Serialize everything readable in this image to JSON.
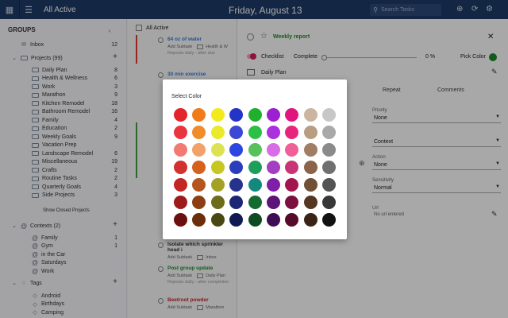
{
  "header": {
    "view_title": "All Active",
    "date": "Friday, August 13",
    "search_placeholder": "Search Tasks"
  },
  "sidebar": {
    "groups_title": "GROUPS",
    "inbox": {
      "label": "Inbox",
      "count": "12"
    },
    "projects": {
      "label": "Projects (99)"
    },
    "project_items": [
      {
        "label": "Daily Plan",
        "count": "8"
      },
      {
        "label": "Health & Wellness",
        "count": "6"
      },
      {
        "label": "Work",
        "count": "3"
      },
      {
        "label": "Marathon",
        "count": "9"
      },
      {
        "label": "Kitchen Remodel",
        "count": "18"
      },
      {
        "label": "Bathroom Remodel",
        "count": "16"
      },
      {
        "label": "Family",
        "count": "4"
      },
      {
        "label": "Education",
        "count": "2"
      },
      {
        "label": "Weekly Goals",
        "count": "9"
      },
      {
        "label": "Vacation Prep",
        "count": ""
      },
      {
        "label": "Landscape Remodel",
        "count": "6"
      },
      {
        "label": "Miscellaneous",
        "count": "19"
      },
      {
        "label": "Crafts",
        "count": "2"
      },
      {
        "label": "Routine Tasks",
        "count": "2"
      },
      {
        "label": "Quarterly Goals",
        "count": "4"
      },
      {
        "label": "Side Projects",
        "count": "3"
      }
    ],
    "show_closed": "Show Closed Projects",
    "contexts": {
      "label": "Contexts (2)"
    },
    "context_items": [
      {
        "label": "Family",
        "count": "1"
      },
      {
        "label": "Gym",
        "count": "1"
      },
      {
        "label": "in the Car",
        "count": ""
      },
      {
        "label": "Saturdays",
        "count": ""
      },
      {
        "label": "Work",
        "count": ""
      }
    ],
    "tags": {
      "label": "Tags"
    },
    "tag_items": [
      {
        "label": "Android"
      },
      {
        "label": "Birthdays"
      },
      {
        "label": "Camping"
      }
    ]
  },
  "tasklist": {
    "header": "All Active",
    "tasks": [
      {
        "title": "64 oz of water",
        "sub": "Add Subtask",
        "project": "Health & W",
        "note": "Repeats daily - after due",
        "color": "#3a7bd5"
      },
      {
        "title": "30 min exercise",
        "sub": "",
        "project": "",
        "note": "",
        "color": "#3a7bd5"
      },
      {
        "title": "Isolate which sprinkler head i",
        "sub": "Add Subtask",
        "project": "Inbox",
        "note": "",
        "color": "#333333"
      },
      {
        "title": "Post group update",
        "sub": "Add Subtask",
        "project": "Daily Plan",
        "note": "Repeats daily - after completion",
        "color": "#1d8a2b"
      },
      {
        "title": "Beetroot powder",
        "sub": "Add Subtask",
        "project": "Marathon",
        "note": "",
        "color": "#c62828"
      }
    ]
  },
  "detail": {
    "title": "Weekly report",
    "checklist": "Checklist",
    "complete": "Complete",
    "percent": "0 %",
    "pick_color": "Pick Color",
    "project": "Daily Plan",
    "tabs": [
      "Repeat",
      "Comments"
    ],
    "priority_label": "Priority",
    "priority_value": "None",
    "context_value": "Context",
    "action_label": "Action",
    "action_value": "None",
    "sensitivity_label": "Sensitivity",
    "sensitivity_value": "Normal",
    "url_label": "Url",
    "url_value": "No url entered"
  },
  "modal": {
    "title": "Select Color",
    "colors": [
      [
        "#e3242b",
        "#f07b1a",
        "#f3ea1d",
        "#2433c8",
        "#1fb030",
        "#9c1fd1",
        "#e0157e",
        "#cbb59e",
        "#c7c7c7"
      ],
      [
        "#e8353e",
        "#f08c2a",
        "#eaea2b",
        "#3b47d6",
        "#2dc046",
        "#aa31de",
        "#e8257c",
        "#b99d81",
        "#a9a9a9"
      ],
      [
        "#f37a73",
        "#f3a16a",
        "#dde254",
        "#2c47e0",
        "#58c25a",
        "#d86be6",
        "#f05f97",
        "#a17d63",
        "#8a8a8a"
      ],
      [
        "#d13131",
        "#d5611f",
        "#c8c620",
        "#2b3cbd",
        "#1e9e5b",
        "#a43ec2",
        "#c83577",
        "#8a6349",
        "#707070"
      ],
      [
        "#c42525",
        "#b4561f",
        "#a3a126",
        "#27328f",
        "#13887d",
        "#7f1fa8",
        "#a3154f",
        "#704f35",
        "#545454"
      ],
      [
        "#9e1b1b",
        "#8c3e12",
        "#6d6b1c",
        "#1d2675",
        "#156a32",
        "#5c1578",
        "#7b103e",
        "#553621",
        "#383838"
      ],
      [
        "#6b0f0f",
        "#6b2d0c",
        "#4a4812",
        "#121a56",
        "#0e4a22",
        "#3f0d54",
        "#560a2c",
        "#3a2314",
        "#121212"
      ]
    ]
  }
}
